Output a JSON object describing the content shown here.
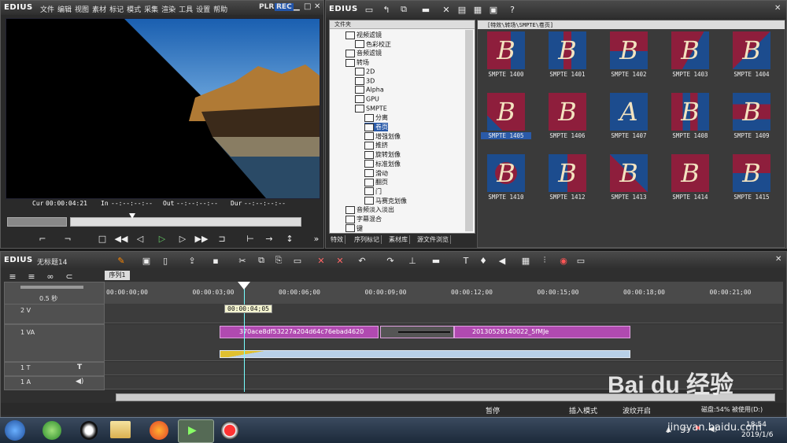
{
  "player": {
    "logo": "EDIUS",
    "menu": [
      "文件",
      "编辑",
      "视图",
      "素材",
      "标记",
      "模式",
      "采集",
      "渲染",
      "工具",
      "设置",
      "帮助"
    ],
    "plr": "PLR",
    "rec": "REC",
    "cur_label": "Cur",
    "cur_value": "00:00:04:21",
    "in_label": "In",
    "in_value": "--:--:--:--",
    "out_label": "Out",
    "out_value": "--:--:--:--",
    "dur_label": "Dur",
    "dur_value": "--:--:--:--"
  },
  "effects": {
    "logo": "EDIUS",
    "folder_title": "文件夹",
    "path": "[特效\\转场\\SMPTE\\卷页]",
    "tree": [
      {
        "label": "视频滤镜",
        "level": 1
      },
      {
        "label": "色彩校正",
        "level": 2
      },
      {
        "label": "音频滤镜",
        "level": 1
      },
      {
        "label": "转场",
        "level": 1
      },
      {
        "label": "2D",
        "level": 2
      },
      {
        "label": "3D",
        "level": 2
      },
      {
        "label": "Alpha",
        "level": 2
      },
      {
        "label": "GPU",
        "level": 2
      },
      {
        "label": "SMPTE",
        "level": 2
      },
      {
        "label": "分离",
        "level": 3
      },
      {
        "label": "卷页",
        "level": 3
      },
      {
        "label": "增强划像",
        "level": 3
      },
      {
        "label": "推挤",
        "level": 3
      },
      {
        "label": "旋转划像",
        "level": 3
      },
      {
        "label": "标准划像",
        "level": 3
      },
      {
        "label": "滑动",
        "level": 3
      },
      {
        "label": "翻页",
        "level": 3
      },
      {
        "label": "门",
        "level": 3
      },
      {
        "label": "马赛克划像",
        "level": 3
      },
      {
        "label": "音频淡入淡出",
        "level": 1
      },
      {
        "label": "字幕混合",
        "level": 1
      },
      {
        "label": "键",
        "level": 1
      }
    ],
    "tabs": [
      "特效",
      "序列标记",
      "素材库",
      "源文件浏览"
    ],
    "thumbs": [
      {
        "label": "SMPTE 1400",
        "letter": "B"
      },
      {
        "label": "SMPTE 1401",
        "letter": "B"
      },
      {
        "label": "SMPTE 1402",
        "letter": "B"
      },
      {
        "label": "SMPTE 1403",
        "letter": "B"
      },
      {
        "label": "SMPTE 1404",
        "letter": "B"
      },
      {
        "label": "SMPTE 1405",
        "letter": "B"
      },
      {
        "label": "SMPTE 1406",
        "letter": "B"
      },
      {
        "label": "SMPTE 1407",
        "letter": "A"
      },
      {
        "label": "SMPTE 1408",
        "letter": "B"
      },
      {
        "label": "SMPTE 1409",
        "letter": "B"
      },
      {
        "label": "SMPTE 1410",
        "letter": "B"
      },
      {
        "label": "SMPTE 1412",
        "letter": "B"
      },
      {
        "label": "SMPTE 1413",
        "letter": "B"
      },
      {
        "label": "SMPTE 1414",
        "letter": "B"
      },
      {
        "label": "SMPTE 1415",
        "letter": "B"
      }
    ]
  },
  "timeline": {
    "logo": "EDIUS",
    "project": "无标题14",
    "sequence_tab": "序列1",
    "zoom": "0.5 秒",
    "ruler": [
      "00:00:00;00",
      "00:00:03;00",
      "00:00:06;00",
      "00:00:09;00",
      "00:00:12;00",
      "00:00:15;00",
      "00:00:18;00",
      "00:00:21;00"
    ],
    "tooltip": "00:00:04;05",
    "tracks": [
      {
        "name": "2 V"
      },
      {
        "name": "1 VA"
      },
      {
        "name": "1 T"
      },
      {
        "name": "1 A"
      }
    ],
    "clip1": "370ace8df53227a204d64c76ebad4620",
    "clip2": "20130526140022_5fMJe"
  },
  "status": {
    "pause": "暂停",
    "insert_mode": "插入模式",
    "ripple": "波纹开启",
    "disk": "磁盘:54% 被使用(D:)"
  },
  "taskbar": {
    "time": "18:54",
    "date": "2019/1/6"
  },
  "watermark": {
    "brand": "Bai du 经验",
    "url": "jingyan.baidu.com"
  }
}
